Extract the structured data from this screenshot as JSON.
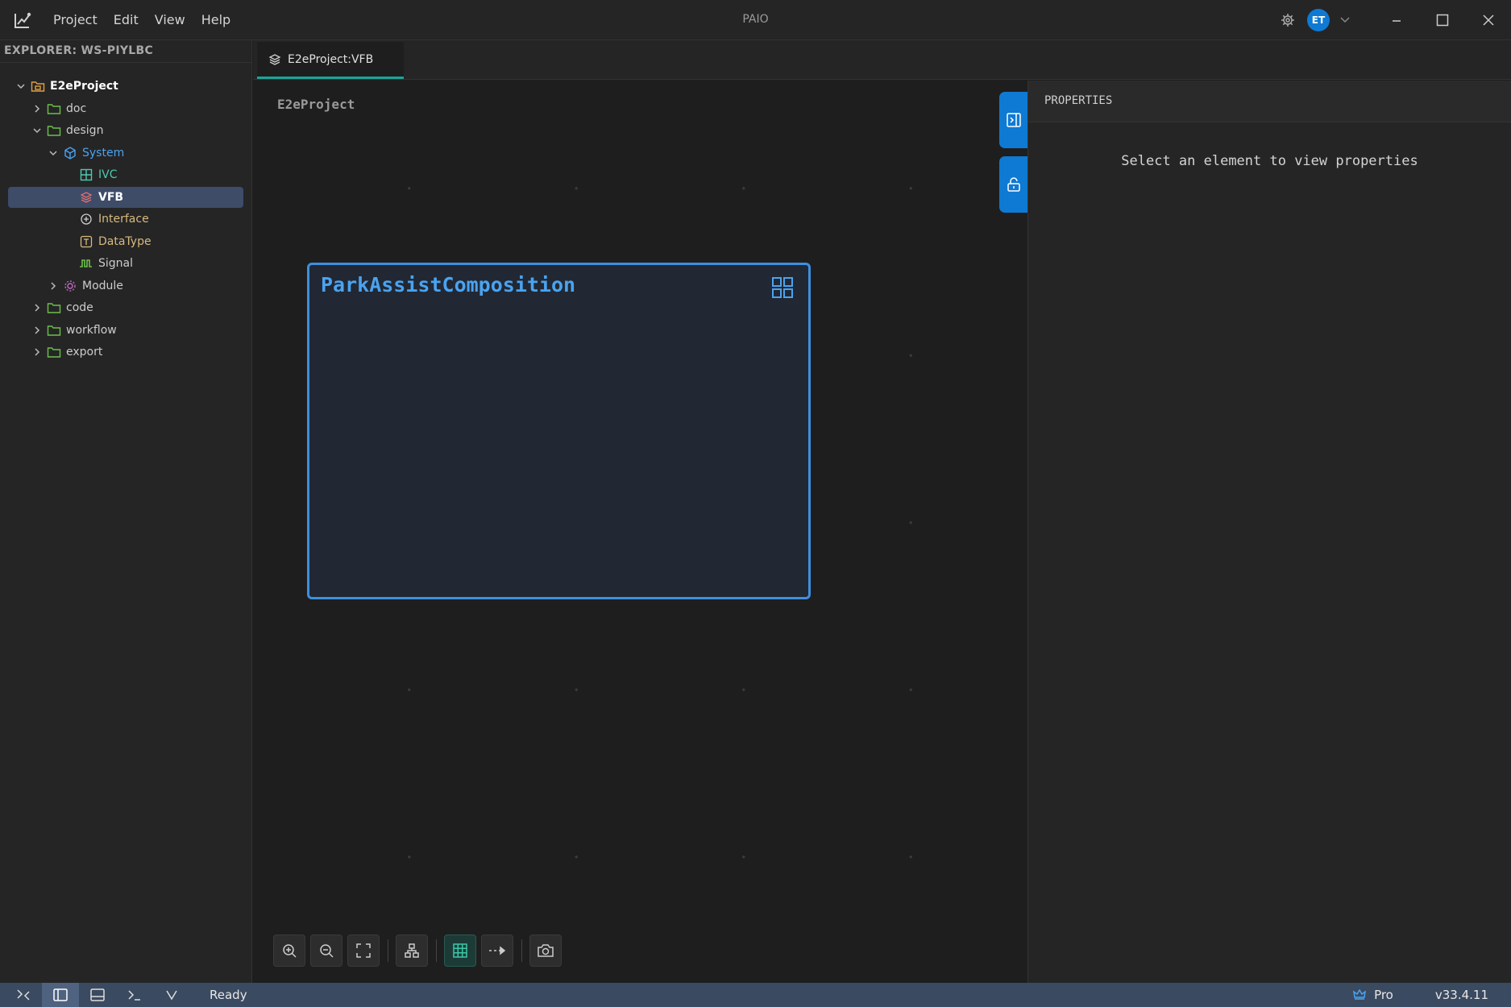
{
  "window": {
    "title": "PAIO",
    "menu": [
      "Project",
      "Edit",
      "View",
      "Help"
    ],
    "user_initials": "ET"
  },
  "explorer": {
    "title": "EXPLORER: WS-PIYLBC",
    "items": [
      {
        "label": "E2eProject",
        "depth": 0,
        "expanded": true,
        "icon": "project-icon",
        "color": "#ffffff",
        "bold": true
      },
      {
        "label": "doc",
        "depth": 1,
        "expanded": false,
        "icon": "folder-icon"
      },
      {
        "label": "design",
        "depth": 1,
        "expanded": true,
        "icon": "folder-icon"
      },
      {
        "label": "System",
        "depth": 2,
        "expanded": true,
        "icon": "cube-icon",
        "color": "#4aa3f0"
      },
      {
        "label": "IVC",
        "depth": 3,
        "icon": "grid-table-icon",
        "color": "#4ec9b0"
      },
      {
        "label": "VFB",
        "depth": 3,
        "icon": "layers-icon",
        "selected": true
      },
      {
        "label": "Interface",
        "depth": 3,
        "icon": "interface-icon",
        "color": "#d7ba7d"
      },
      {
        "label": "DataType",
        "depth": 3,
        "icon": "datatype-icon",
        "color": "#d7ba7d"
      },
      {
        "label": "Signal",
        "depth": 3,
        "icon": "signal-icon",
        "color": "#cccccc"
      },
      {
        "label": "Module",
        "depth": 2,
        "expanded": false,
        "icon": "module-icon"
      },
      {
        "label": "code",
        "depth": 1,
        "expanded": false,
        "icon": "folder-icon"
      },
      {
        "label": "workflow",
        "depth": 1,
        "expanded": false,
        "icon": "folder-icon"
      },
      {
        "label": "export",
        "depth": 1,
        "expanded": false,
        "icon": "folder-icon"
      }
    ]
  },
  "tabs": [
    {
      "label": "E2eProject:VFB",
      "active": true,
      "icon": "layers-icon"
    }
  ],
  "canvas": {
    "breadcrumb": "E2eProject",
    "composition": {
      "title": "ParkAssistComposition"
    }
  },
  "properties": {
    "title": "PROPERTIES",
    "empty_message": "Select an element to view properties"
  },
  "statusbar": {
    "status": "Ready",
    "plan": "Pro",
    "version": "v33.4.11"
  },
  "colors": {
    "accent": "#0e7ad3",
    "composition_border": "#3d8fe0",
    "tab_indicator": "#1aa59a",
    "folder": "#6cc04a"
  }
}
